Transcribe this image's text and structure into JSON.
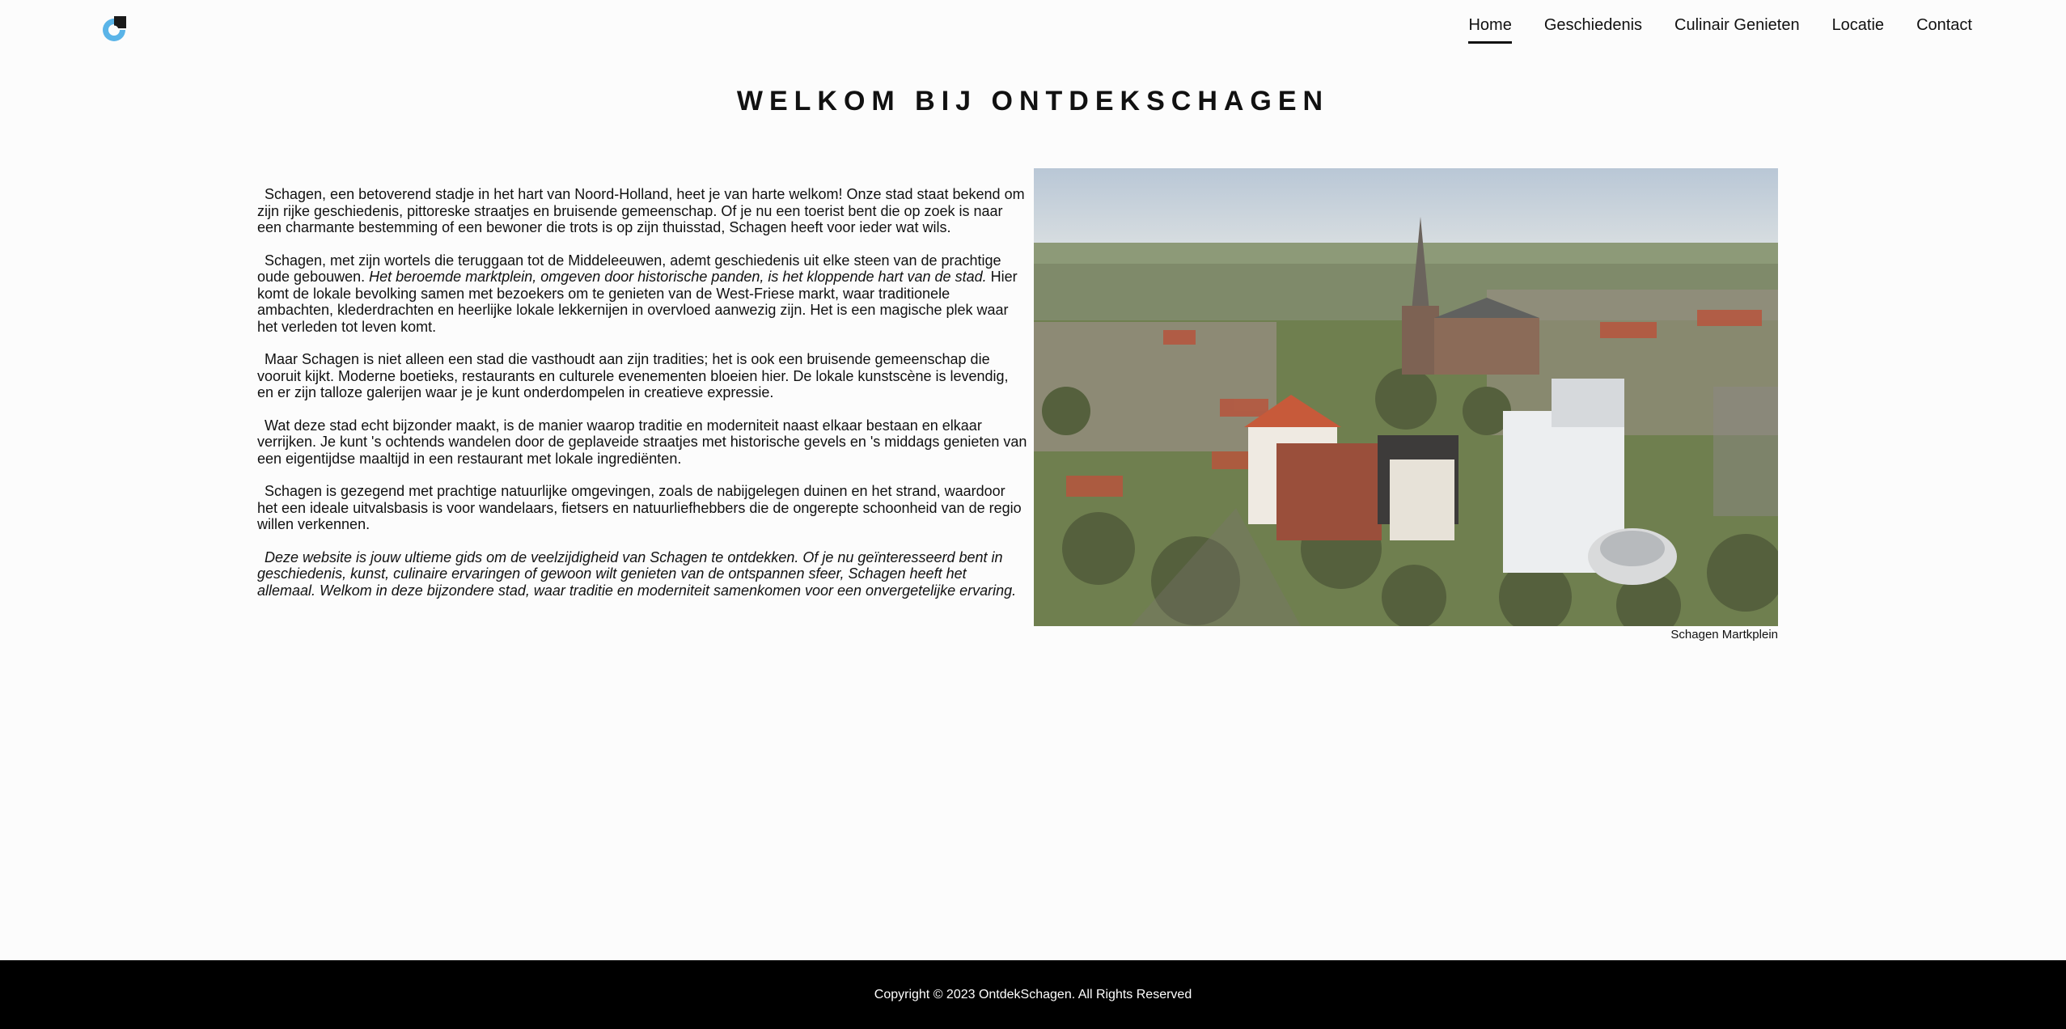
{
  "brand": {
    "logo_icon": "ontdekschagen-logo-icon",
    "accent": "#5ab4e8"
  },
  "nav": {
    "items": [
      {
        "label": "Home",
        "active": true
      },
      {
        "label": "Geschiedenis",
        "active": false
      },
      {
        "label": "Culinair Genieten",
        "active": false
      },
      {
        "label": "Locatie",
        "active": false
      },
      {
        "label": "Contact",
        "active": false
      }
    ]
  },
  "main": {
    "title": "Welkom bij OntdekSchagen",
    "paragraphs": [
      {
        "text": "Schagen, een betoverend stadje in het hart van Noord-Holland, heet je van harte welkom! Onze stad staat bekend om zijn rijke geschiedenis, pittoreske straatjes en bruisende gemeenschap. Of je nu een toerist bent die op zoek is naar een charmante bestemming of een bewoner die trots is op zijn thuisstad, Schagen heeft voor ieder wat wils."
      },
      {
        "text_start": "Schagen, met zijn wortels die teruggaan tot de Middeleeuwen, ademt geschiedenis uit elke steen van de prachtige oude gebouwen. ",
        "text_italic": "Het beroemde marktplein, omgeven door historische panden, is het kloppende hart van de stad.",
        "text_end": " Hier komt de lokale bevolking samen met bezoekers om te genieten van de West-Friese markt, waar traditionele ambachten, klederdrachten en heerlijke lokale lekkernijen in overvloed aanwezig zijn. Het is een magische plek waar het verleden tot leven komt."
      },
      {
        "text": "Maar Schagen is niet alleen een stad die vasthoudt aan zijn tradities; het is ook een bruisende gemeenschap die vooruit kijkt. Moderne boetieks, restaurants en culturele evenementen bloeien hier. De lokale kunstscène is levendig, en er zijn talloze galerijen waar je je kunt onderdompelen in creatieve expressie."
      },
      {
        "text": "Wat deze stad echt bijzonder maakt, is de manier waarop traditie en moderniteit naast elkaar bestaan en elkaar verrijken. Je kunt 's ochtends wandelen door de geplaveide straatjes met historische gevels en 's middags genieten van een eigentijdse maaltijd in een restaurant met lokale ingrediënten."
      },
      {
        "text": "Schagen is gezegend met prachtige natuurlijke omgevingen, zoals de nabijgelegen duinen en het strand, waardoor het een ideale uitvalsbasis is voor wandelaars, fietsers en natuurliefhebbers die de ongerepte schoonheid van de regio willen verkennen."
      },
      {
        "text_italic": "Deze website is jouw ultieme gids om de veelzijdigheid van Schagen te ontdekken. Of je nu geïnteresseerd bent in geschiedenis, kunst, culinaire ervaringen of gewoon wilt genieten van de ontspannen sfeer, Schagen heeft het allemaal. Welkom in deze bijzondere stad, waar traditie en moderniteit samenkomen voor een onvergetelijke ervaring."
      }
    ],
    "image": {
      "caption": "Schagen Martkplein"
    }
  },
  "footer": {
    "copyright": "Copyright © 2023 OntdekSchagen. All Rights Reserved"
  }
}
